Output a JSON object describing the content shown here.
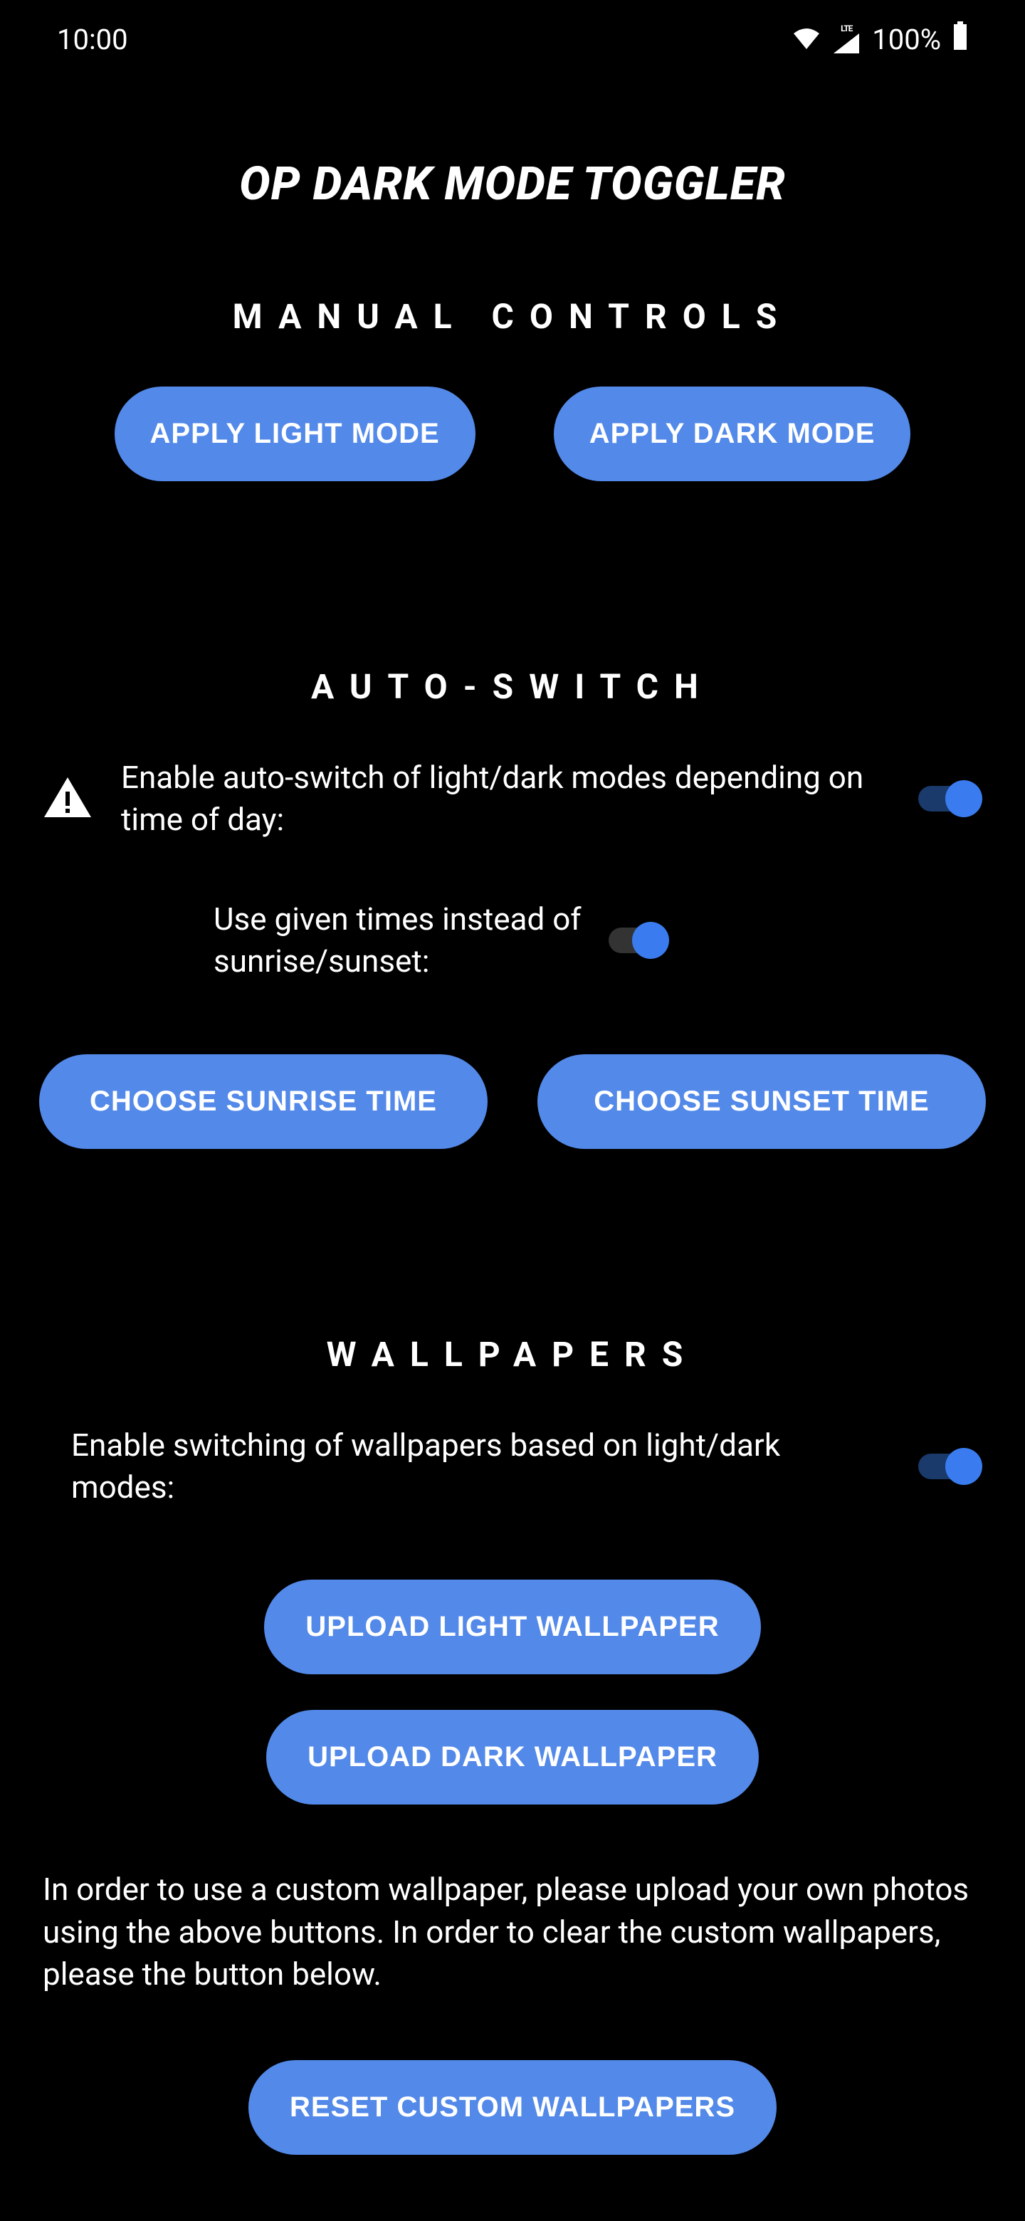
{
  "status_bar": {
    "time": "10:00",
    "battery": "100%",
    "lte": "LTE"
  },
  "app_title": "OP DARK MODE TOGGLER",
  "sections": {
    "manual": {
      "heading": "MANUAL CONTROLS",
      "apply_light": "APPLY LIGHT MODE",
      "apply_dark": "APPLY DARK MODE"
    },
    "auto": {
      "heading": "AUTO-SWITCH",
      "enable_label": "Enable auto-switch of light/dark modes depending on time of day:",
      "use_times_label": "Use given times instead of sunrise/sunset:",
      "choose_sunrise": "CHOOSE SUNRISE TIME",
      "choose_sunset": "CHOOSE SUNSET TIME"
    },
    "wallpapers": {
      "heading": "WALLPAPERS",
      "enable_label": "Enable switching of wallpapers based on light/dark modes:",
      "upload_light": "UPLOAD LIGHT WALLPAPER",
      "upload_dark": "UPLOAD DARK WALLPAPER",
      "description": "In order to use a custom wallpaper, please upload your own photos using the above buttons. In order to clear the custom wallpapers, please the button below.",
      "reset": "RESET CUSTOM WALLPAPERS"
    }
  }
}
